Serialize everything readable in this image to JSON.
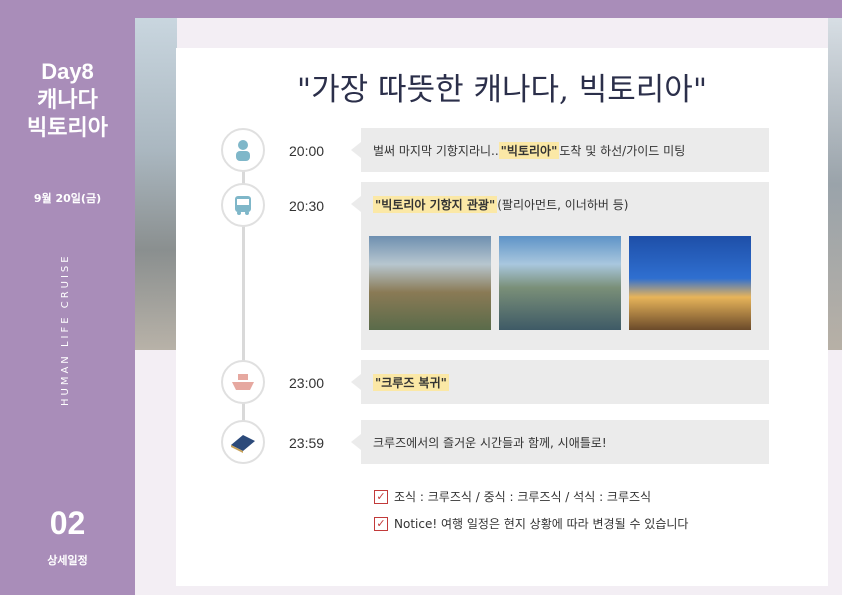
{
  "sidebar": {
    "day": "Day8",
    "country": "캐나다",
    "city": "빅토리아",
    "date": "9월 20일(금)",
    "vertical_text": "HUMAN LIFE CRUISE",
    "section_number": "02",
    "section_label": "상세일정"
  },
  "title": "\"가장 따뜻한 캐나다, 빅토리아\"",
  "schedule": [
    {
      "time": "20:00",
      "icon": "woman-guide-icon",
      "pre": "벌써 마지막 기항지라니.. ",
      "highlight": "\"빅토리아\"",
      "post": " 도착 및 하선/가이드 미팅"
    },
    {
      "time": "20:30",
      "icon": "bus-icon",
      "pre": "",
      "highlight": "\"빅토리아 기항지 관광\"",
      "post": " (팔리아먼트, 이너하버 등)"
    },
    {
      "time": "23:00",
      "icon": "cruise-ship-icon",
      "pre": "",
      "highlight": "\"크루즈 복귀\"",
      "post": ""
    },
    {
      "time": "23:59",
      "icon": "bed-icon",
      "pre": "크루즈에서의 즐거운 시간들과 함께, 시애틀로!",
      "highlight": "",
      "post": ""
    }
  ],
  "notes": {
    "meals": "조식 : 크루즈식   /  중식 : 크루즈식   /  석식 : 크루즈식",
    "notice": "Notice!  여행 일정은 현지 상황에 따라 변경될 수 있습니다"
  },
  "colors": {
    "sidebar": "#a98db9",
    "highlight": "#fbe8a6",
    "checkbox": "#c23a3a"
  }
}
